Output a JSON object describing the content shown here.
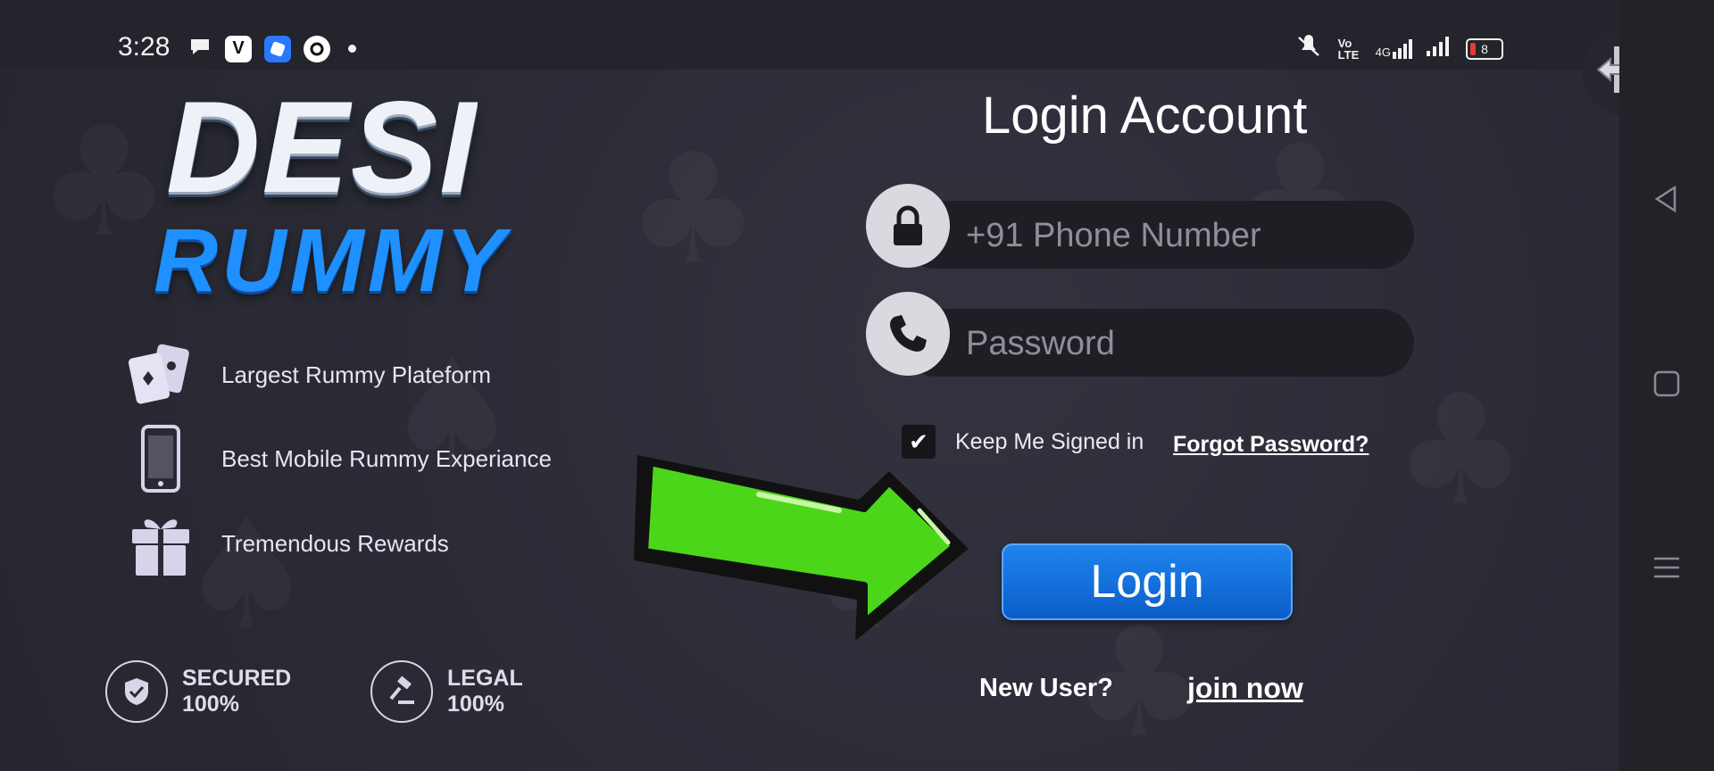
{
  "status_bar": {
    "time": "3:28",
    "left_icons": [
      "chat-bubble-icon",
      "v-app-icon",
      "blue-app-icon",
      "link-app-icon",
      "dot-icon"
    ],
    "right_icons": [
      "mute-vibrate-icon",
      "volte-icon",
      "4g-signal-icon",
      "signal-icon"
    ],
    "volte_label": "Vo LTE",
    "network_label": "4G",
    "battery_level": "8"
  },
  "logo": {
    "line1": "DESI",
    "line2": "RUMMY"
  },
  "features": [
    {
      "label": "Largest Rummy Plateform",
      "icon": "playing-cards-icon"
    },
    {
      "label": "Best Mobile Rummy Experiance",
      "icon": "mobile-phone-icon"
    },
    {
      "label": "Tremendous Rewards",
      "icon": "gift-icon"
    }
  ],
  "badges": [
    {
      "line1": "SECURED",
      "line2": "100%",
      "icon": "shield-check-icon"
    },
    {
      "line1": "LEGAL",
      "line2": "100%",
      "icon": "gavel-icon"
    }
  ],
  "login": {
    "title": "Login Account",
    "phone_placeholder": "+91 Phone Number",
    "password_placeholder": "Password",
    "keep_signed_in_label": "Keep Me Signed in",
    "keep_signed_in_checked": true,
    "forgot_password_label": "Forgot Password?",
    "login_button_label": "Login",
    "new_user_label": "New User?",
    "join_now_label": "join now"
  },
  "colors": {
    "background": "#2a2a35",
    "login_button": "#1f84ee",
    "logo_blue": "#1e90ff",
    "arrow_green": "#4cd61a"
  }
}
